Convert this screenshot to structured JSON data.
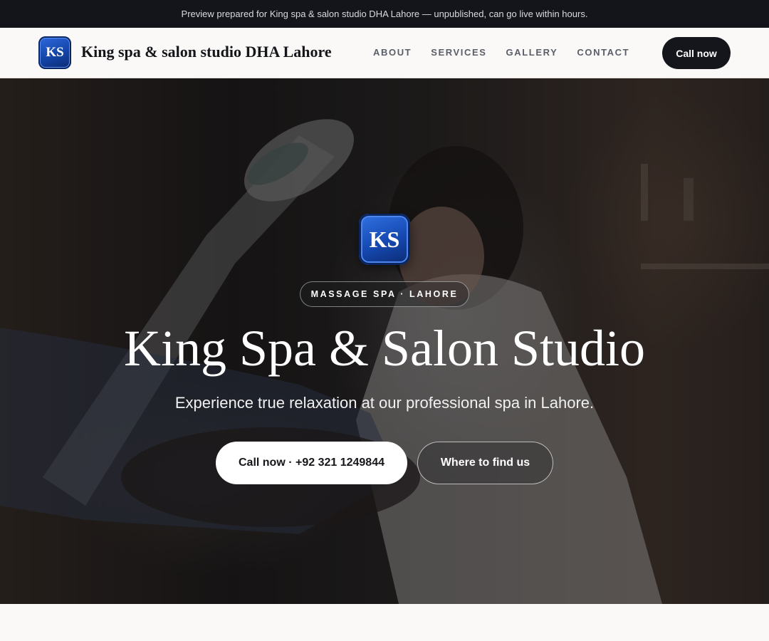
{
  "preview_bar": {
    "text": "Preview prepared for King spa & salon studio DHA Lahore — unpublished, can go live within hours."
  },
  "header": {
    "logo_text": "KS",
    "brand_name": "King spa & salon studio DHA Lahore",
    "nav": [
      {
        "label": "ABOUT"
      },
      {
        "label": "SERVICES"
      },
      {
        "label": "GALLERY"
      },
      {
        "label": "CONTACT"
      }
    ],
    "call_button": "Call now"
  },
  "hero": {
    "logo_text": "KS",
    "badge": "MASSAGE SPA · LAHORE",
    "title": "King Spa & Salon Studio",
    "subtitle": "Experience true relaxation at our professional spa in Lahore.",
    "call_button": "Call now · +92 321 1249844",
    "find_button": "Where to find us",
    "background_image": "spa-treatment-photo"
  },
  "colors": {
    "topbar_bg": "#13151b",
    "header_bg": "#faf9f7",
    "dark_button": "#14161c",
    "logo_blue": "#1548b0"
  }
}
